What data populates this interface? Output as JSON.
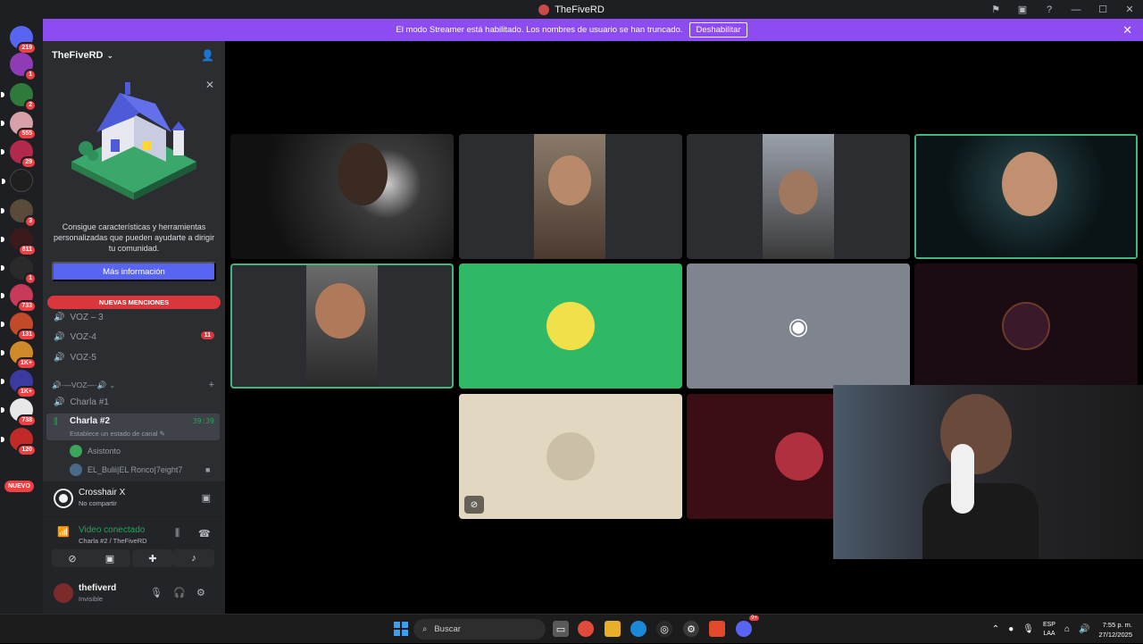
{
  "window": {
    "title": "TheFiveRD"
  },
  "banner": {
    "message": "El modo Streamer está habilitado. Los nombres de usuario se han truncado.",
    "button": "Deshabilitar"
  },
  "servers": [
    {
      "name": "discord-home-icon",
      "badge": "219",
      "color": "#5865f2"
    },
    {
      "name": "server-1",
      "badge": "1",
      "color": "#8e3bb5"
    },
    {
      "name": "server-ct",
      "badge": "2",
      "color": "#2f7a3b"
    },
    {
      "name": "server-3",
      "badge": "555",
      "color": "#d8a0a8"
    },
    {
      "name": "server-4",
      "badge": "29",
      "color": "#b3294b"
    },
    {
      "name": "server-5",
      "badge": "",
      "color": "#1f1f1f"
    },
    {
      "name": "server-6",
      "badge": "3",
      "color": "#5a4a3a"
    },
    {
      "name": "server-7",
      "badge": "811",
      "color": "#3a1a1a"
    },
    {
      "name": "server-8",
      "badge": "1",
      "color": "#2a2a2a"
    },
    {
      "name": "server-9",
      "badge": "733",
      "color": "#c93a5a"
    },
    {
      "name": "server-10",
      "badge": "131",
      "color": "#c24a2a"
    },
    {
      "name": "server-11",
      "badge": "1K+",
      "color": "#d08a2a"
    },
    {
      "name": "server-12",
      "badge": "1K+",
      "color": "#3a3aa0"
    },
    {
      "name": "server-13",
      "badge": "738",
      "color": "#e8e8e8"
    },
    {
      "name": "server-14",
      "badge": "120",
      "color": "#c22a2a"
    }
  ],
  "new_label": "NUEVO",
  "guild": {
    "name": "TheFiveRD",
    "promo_text": "Consigue características y herramientas personalizadas que pueden ayudarte a dirigir tu comunidad.",
    "promo_button": "Más información",
    "mentions_banner": "NUEVAS MENCIONES",
    "channels": [
      {
        "label": "VOZ – 3",
        "badge": ""
      },
      {
        "label": "VOZ-4",
        "badge": "11"
      },
      {
        "label": "VOZ-5",
        "badge": ""
      }
    ],
    "category": "🔊·—VOZ—·🔊",
    "charla1": "Charla #1",
    "active_channel": {
      "label": "Charla #2",
      "timer": "39:39",
      "status": "Establece un estado de canal"
    },
    "members": [
      {
        "name": "Asistonto"
      },
      {
        "name": "EL_Bulii|EL Ronco|7eight7"
      }
    ]
  },
  "activity": {
    "title": "Crosshair X",
    "subtitle": "No compartir"
  },
  "voice": {
    "status": "Video conectado",
    "location": "Charla #2 / TheFiveRD"
  },
  "user": {
    "name": "thefiverd",
    "status": "Invisible"
  },
  "taskbar": {
    "search_placeholder": "Buscar",
    "lang_1": "ESP",
    "lang_2": "LAA",
    "time": "7:55 p. m.",
    "date": "27/12/2025",
    "discord_badge": "9+"
  },
  "colors": {
    "banner": "#8d4cf0",
    "speaking": "#43b581",
    "mention": "#da373c",
    "blurple": "#5865f2",
    "green_tile": "#2fb865",
    "gray_tile": "#80848e"
  }
}
